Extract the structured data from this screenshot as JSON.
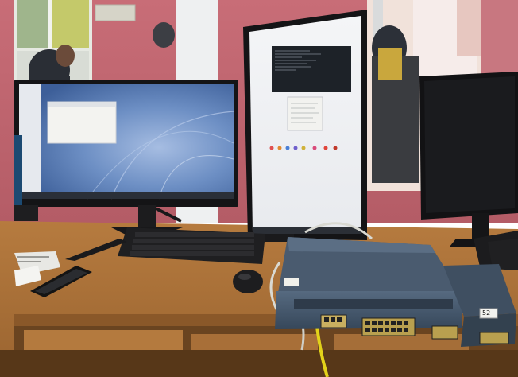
{
  "photo": {
    "subject": "",
    "colors": {
      "wall_pink": "#c9707a",
      "window_frame": "#e9ecee",
      "desk_wood": "#b0763a",
      "desk_dark": "#6e4a22",
      "monitor_bezel": "#1b1b1d",
      "desktop_blue": "#5c7fb8",
      "desktop_blue_light": "#8ea9d6",
      "terminal_bg": "#1e2228",
      "router_body": "#3d4d5e",
      "router_top": "#4c5d70",
      "ethernet_yellow": "#e2d21a",
      "cable_grey": "#d9d9d2"
    },
    "labels": {
      "router_sticker": "",
      "router_port_number": "52"
    }
  }
}
